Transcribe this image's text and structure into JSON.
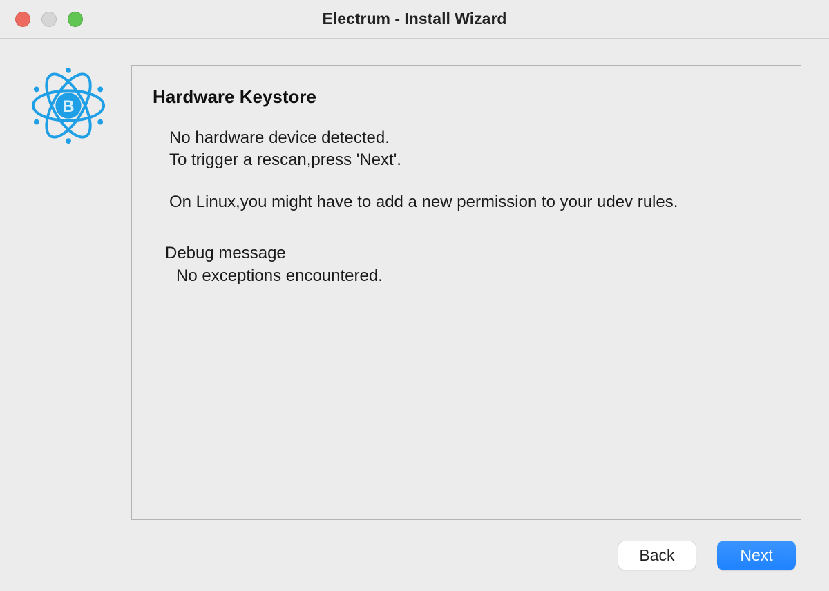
{
  "window": {
    "title": "Electrum  -  Install Wizard"
  },
  "logo": {
    "color": "#1f9fe6",
    "letter": "B"
  },
  "panel": {
    "heading": "Hardware Keystore",
    "message_line1": "No hardware device detected.",
    "message_line2": "To trigger a rescan,press 'Next'.",
    "message_line3": "On Linux,you might have to add a new permission to your udev rules.",
    "debug_label": "Debug message",
    "debug_body": "No exceptions encountered."
  },
  "footer": {
    "back_label": "Back",
    "next_label": "Next"
  }
}
